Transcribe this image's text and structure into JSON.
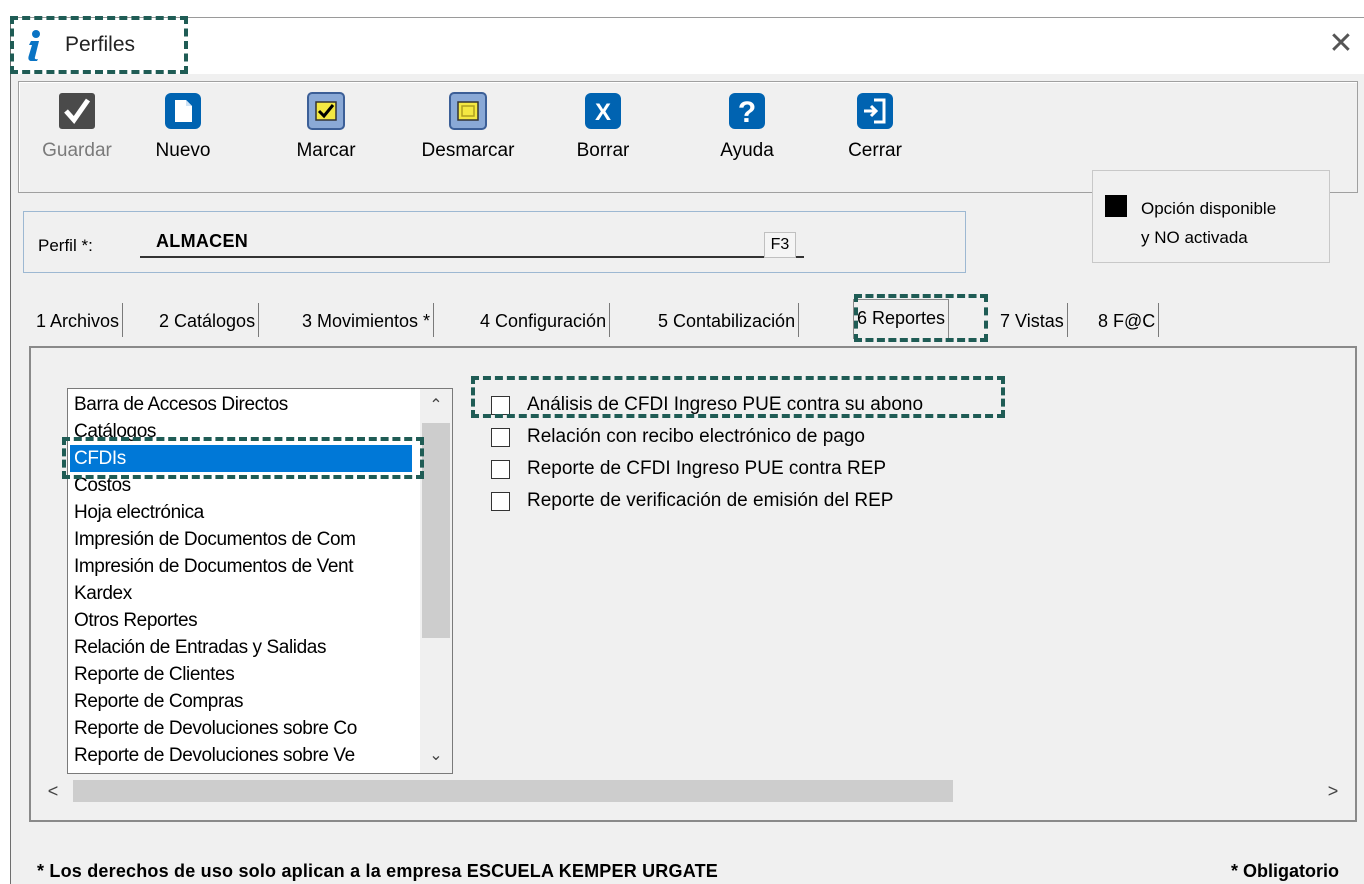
{
  "window": {
    "title": "Perfiles",
    "close_glyph": "✕"
  },
  "toolbar": {
    "buttons": [
      {
        "label": "Guardar",
        "icon": "checkmark-icon",
        "enabled": false
      },
      {
        "label": "Nuevo",
        "icon": "new-document-icon",
        "enabled": true
      },
      {
        "label": "Marcar",
        "icon": "mark-check-icon",
        "enabled": true
      },
      {
        "label": "Desmarcar",
        "icon": "unmark-icon",
        "enabled": true
      },
      {
        "label": "Borrar",
        "icon": "delete-x-icon",
        "enabled": true
      },
      {
        "label": "Ayuda",
        "icon": "help-icon",
        "enabled": true
      },
      {
        "label": "Cerrar",
        "icon": "exit-door-icon",
        "enabled": true
      }
    ]
  },
  "perfil": {
    "label": "Perfil *:",
    "value": "ALMACEN",
    "lookup_key": "F3"
  },
  "legend": {
    "line1": "Opción disponible",
    "line2": "y NO activada",
    "swatch_color": "#000000"
  },
  "tabs": [
    {
      "label": "1 Archivos",
      "active": false
    },
    {
      "label": "2 Catálogos",
      "active": false
    },
    {
      "label": "3 Movimientos *",
      "active": false
    },
    {
      "label": "4 Configuración",
      "active": false
    },
    {
      "label": "5 Contabilización",
      "active": false
    },
    {
      "label": "6 Reportes",
      "active": true
    },
    {
      "label": "7 Vistas",
      "active": false
    },
    {
      "label": "8 F@C",
      "active": false
    }
  ],
  "report_list": {
    "items": [
      "Barra de Accesos Directos",
      "Catálogos",
      "CFDIs",
      "Costos",
      "Hoja electrónica",
      "Impresión de Documentos de Com",
      "Impresión de Documentos de Vent",
      "Kardex",
      "Otros Reportes",
      "Relación de Entradas y Salidas",
      "Reporte de Clientes",
      "Reporte de Compras",
      "Reporte de Devoluciones sobre Co",
      "Reporte de Devoluciones sobre Ve"
    ],
    "selected": "CFDIs"
  },
  "options": [
    {
      "label": "Análisis de CFDI Ingreso PUE contra su abono",
      "checked": false
    },
    {
      "label": "Relación con recibo electrónico de pago",
      "checked": false
    },
    {
      "label": "Reporte de CFDI Ingreso PUE contra REP",
      "checked": false
    },
    {
      "label": "Reporte de verificación de emisión del REP",
      "checked": false
    }
  ],
  "scroll": {
    "up": "⌃",
    "down": "⌄",
    "left": "<",
    "right": ">"
  },
  "footer": {
    "note": "* Los derechos de uso solo aplican a la empresa ESCUELA KEMPER URGATE",
    "required": "* Obligatorio"
  },
  "colors": {
    "highlight": "#1f5c55",
    "selection": "#0078d7",
    "accent_icon": "#0063b1"
  }
}
